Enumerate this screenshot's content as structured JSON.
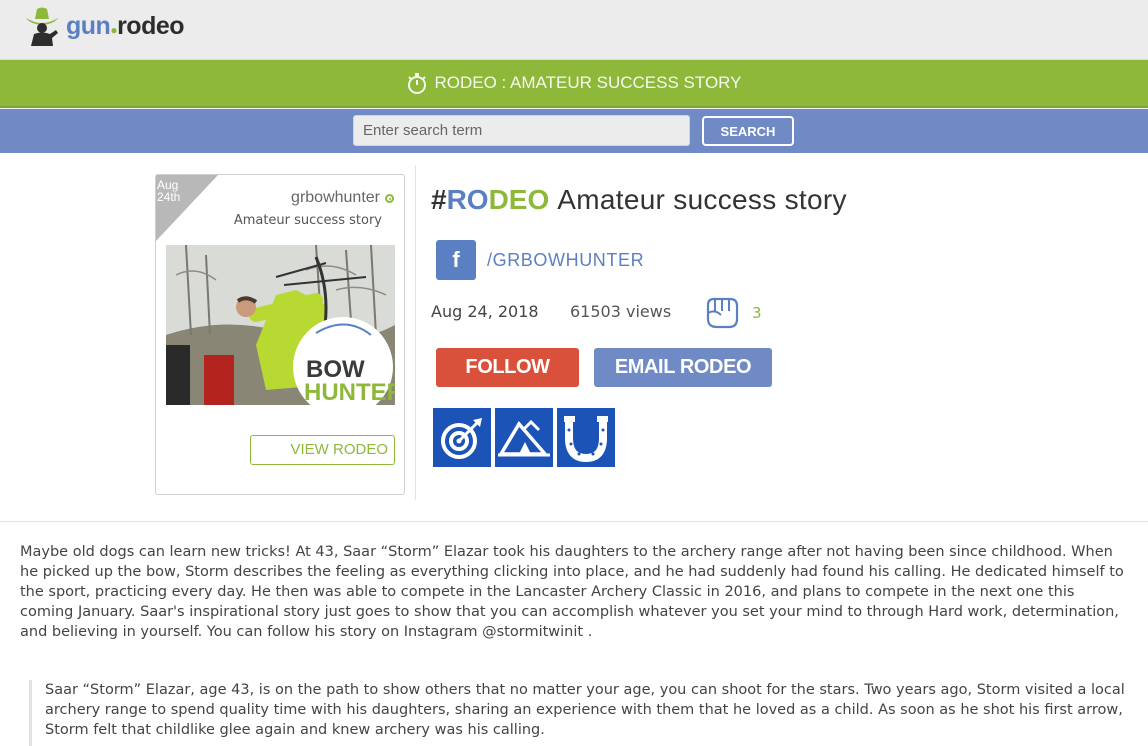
{
  "header": {
    "logo": {
      "part1": "gun",
      "part2": "rodeo"
    }
  },
  "banner": {
    "title": "RODEO : AMATEUR SUCCESS STORY"
  },
  "search": {
    "placeholder": "Enter search term",
    "button_label": "SEARCH"
  },
  "card": {
    "date_line1": "Aug",
    "date_line2": "24th",
    "username": "grbowhunter",
    "subtitle": "Amateur success story",
    "photo_logo_line1": "BOW",
    "photo_logo_line2": "HUNTER",
    "view_label": "VIEW RODEO"
  },
  "post": {
    "hash": "#",
    "tag_ro": "RO",
    "tag_deo": "DEO",
    "title": "Amateur success story",
    "fb_handle": "/GRBOWHUNTER",
    "date": "Aug 24, 2018",
    "views": "61503 views",
    "fist_count": "3",
    "follow_label": "FOLLOW",
    "email_label": "EMAIL RODEO"
  },
  "badges": [
    {
      "icon": "target-icon"
    },
    {
      "icon": "tent-icon"
    },
    {
      "icon": "horseshoe-icon"
    }
  ],
  "content": {
    "paragraph": "Maybe old dogs can learn new tricks! At 43, Saar “Storm” Elazar took his daughters to the archery range after not having been since childhood. When he picked up the bow, Storm describes the feeling as everything clicking into place, and he had suddenly had found his calling. He dedicated himself to the sport, practicing every day. He then was able to compete in the Lancaster Archery Classic in 2016, and plans to compete in the next one this coming January. Saar's inspirational story just goes to show that you can accomplish whatever you set your mind to through Hard work, determination, and believing in yourself. You can follow his story on Instagram @stormitwinit .",
    "quote": "Saar “Storm” Elazar, age 43, is on the path to show others that no matter your age, you can shoot for the stars. Two years ago, Storm visited a local archery range to spend quality time with his daughters, sharing an experience with them that he loved as a child. As soon as he shot his first arrow, Storm felt that childlike glee again and knew archery was his calling."
  },
  "colors": {
    "green": "#8db83a",
    "blue": "#6f8ac5",
    "brand_blue": "#5b7fc3",
    "follow_red": "#d9513a",
    "badge_blue": "#1b53b7"
  }
}
